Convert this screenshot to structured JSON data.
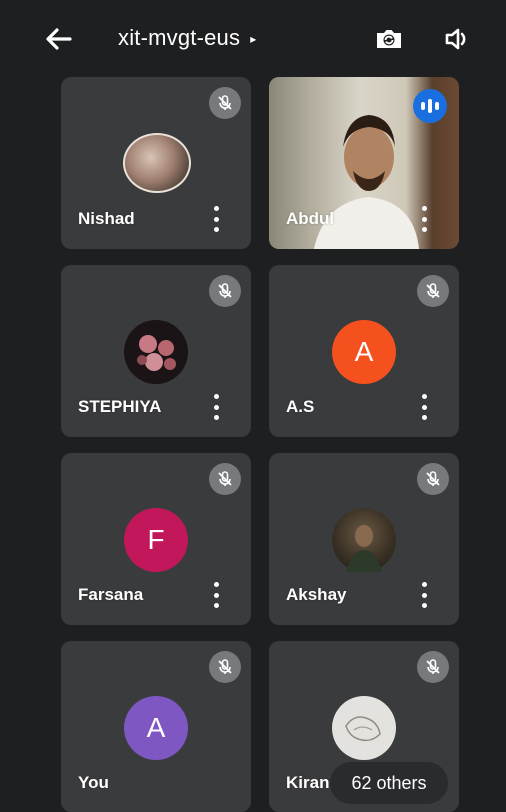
{
  "header": {
    "meeting_code": "xit-mvgt-eus",
    "caret": "▸",
    "icons": [
      "back-arrow-icon",
      "switch-camera-icon",
      "speaker-icon"
    ]
  },
  "participants": [
    {
      "name": "Nishad",
      "avatar_type": "photo",
      "muted": true
    },
    {
      "name": "Abdul",
      "avatar_type": "video",
      "muted": false,
      "speaking": true
    },
    {
      "name": "STEPHIYA",
      "avatar_type": "photo",
      "muted": true
    },
    {
      "name": "A.S",
      "initial": "A",
      "avatar_color": "#f4511e",
      "muted": true
    },
    {
      "name": "Farsana",
      "initial": "F",
      "avatar_color": "#c2185b",
      "muted": true
    },
    {
      "name": "Akshay",
      "avatar_type": "photo",
      "muted": true
    },
    {
      "name": "You",
      "initial": "A",
      "avatar_color": "#7e57c2",
      "muted": true
    },
    {
      "name": "Kiran",
      "avatar_type": "photo",
      "muted": true
    }
  ],
  "others_label": "62 others",
  "colors": {
    "background": "#1e1f21",
    "tile": "#3a3b3d",
    "speaking_accent": "#1a6fe0",
    "mute_badge": "#78797c"
  }
}
